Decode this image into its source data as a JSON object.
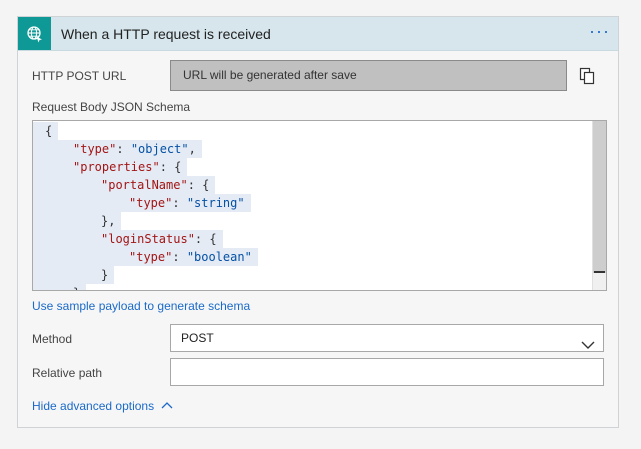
{
  "trigger": {
    "title": "When a HTTP request is received",
    "icon": "globe-request-icon",
    "more_label": "···",
    "accent_color": "#0e9996"
  },
  "http_post_url": {
    "label": "HTTP POST URL",
    "value": "URL will be generated after save",
    "copy_icon": "copy-icon"
  },
  "schema": {
    "label": "Request Body JSON Schema",
    "lines": [
      {
        "indent": 0,
        "parts": [
          {
            "t": "punct",
            "v": "{"
          }
        ]
      },
      {
        "indent": 1,
        "parts": [
          {
            "t": "key",
            "v": "\"type\""
          },
          {
            "t": "punct",
            "v": ": "
          },
          {
            "t": "str",
            "v": "\"object\""
          },
          {
            "t": "punct",
            "v": ","
          }
        ]
      },
      {
        "indent": 1,
        "parts": [
          {
            "t": "key",
            "v": "\"properties\""
          },
          {
            "t": "punct",
            "v": ": {"
          }
        ]
      },
      {
        "indent": 2,
        "parts": [
          {
            "t": "key",
            "v": "\"portalName\""
          },
          {
            "t": "punct",
            "v": ": {"
          }
        ]
      },
      {
        "indent": 3,
        "parts": [
          {
            "t": "key",
            "v": "\"type\""
          },
          {
            "t": "punct",
            "v": ": "
          },
          {
            "t": "str",
            "v": "\"string\""
          }
        ]
      },
      {
        "indent": 2,
        "parts": [
          {
            "t": "punct",
            "v": "},"
          }
        ]
      },
      {
        "indent": 2,
        "parts": [
          {
            "t": "key",
            "v": "\"loginStatus\""
          },
          {
            "t": "punct",
            "v": ": {"
          }
        ]
      },
      {
        "indent": 3,
        "parts": [
          {
            "t": "key",
            "v": "\"type\""
          },
          {
            "t": "punct",
            "v": ": "
          },
          {
            "t": "str",
            "v": "\"boolean\""
          }
        ]
      },
      {
        "indent": 2,
        "parts": [
          {
            "t": "punct",
            "v": "}"
          }
        ]
      },
      {
        "indent": 1,
        "parts": [
          {
            "t": "punct",
            "v": "}"
          }
        ]
      }
    ]
  },
  "sample_payload_link": "Use sample payload to generate schema",
  "method": {
    "label": "Method",
    "selected": "POST"
  },
  "relative_path": {
    "label": "Relative path",
    "value": ""
  },
  "advanced_toggle": "Hide advanced options"
}
